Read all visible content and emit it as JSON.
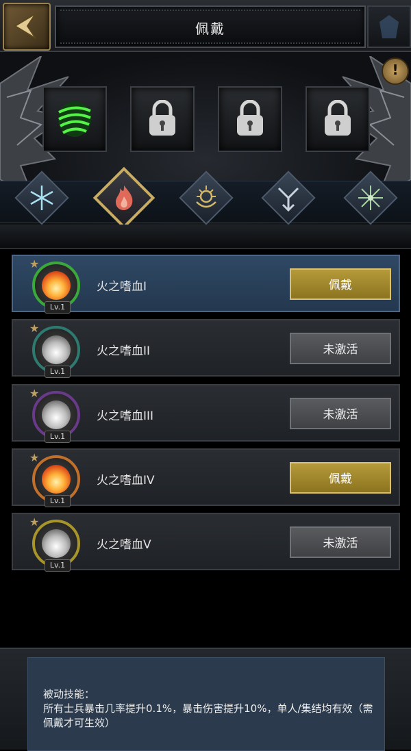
{
  "header": {
    "title": "佩戴"
  },
  "skill_slots": [
    {
      "state": "equipped",
      "icon": "green-wind-icon"
    },
    {
      "state": "locked",
      "icon": "padlock-icon"
    },
    {
      "state": "locked",
      "icon": "padlock-icon"
    },
    {
      "state": "locked",
      "icon": "padlock-icon"
    }
  ],
  "element_tabs": [
    {
      "name": "ice",
      "icon": "snowflake-icon",
      "selected": false
    },
    {
      "name": "fire",
      "icon": "flame-icon",
      "selected": true
    },
    {
      "name": "light",
      "icon": "sun-wreath-icon",
      "selected": false
    },
    {
      "name": "wind",
      "icon": "arrow-emblem-icon",
      "selected": false
    },
    {
      "name": "nature",
      "icon": "starburst-icon",
      "selected": false
    }
  ],
  "skills": [
    {
      "name": "火之嗜血I",
      "level": "Lv.1",
      "button": "佩戴",
      "button_state": "equip",
      "ring_color": "#3aa83a",
      "core": "fire",
      "active": true
    },
    {
      "name": "火之嗜血II",
      "level": "Lv.1",
      "button": "未激活",
      "button_state": "inactive",
      "ring_color": "#2f7a70",
      "core": "grey",
      "active": false
    },
    {
      "name": "火之嗜血III",
      "level": "Lv.1",
      "button": "未激活",
      "button_state": "inactive",
      "ring_color": "#6a3a8a",
      "core": "grey",
      "active": false
    },
    {
      "name": "火之嗜血IV",
      "level": "Lv.1",
      "button": "佩戴",
      "button_state": "equip",
      "ring_color": "#c0702a",
      "core": "fire",
      "active": false
    },
    {
      "name": "火之嗜血V",
      "level": "Lv.1",
      "button": "未激活",
      "button_state": "inactive",
      "ring_color": "#a8952a",
      "core": "grey",
      "active": false
    }
  ],
  "description": {
    "label": "被动技能：",
    "text": "所有士兵暴击几率提升0.1%，暴击伤害提升10%，单人/集结均有效（需佩戴才可生效）"
  },
  "colors": {
    "equip_button": "#b69a3a",
    "inactive_button": "#595b5e",
    "active_row": "#2f4864"
  }
}
